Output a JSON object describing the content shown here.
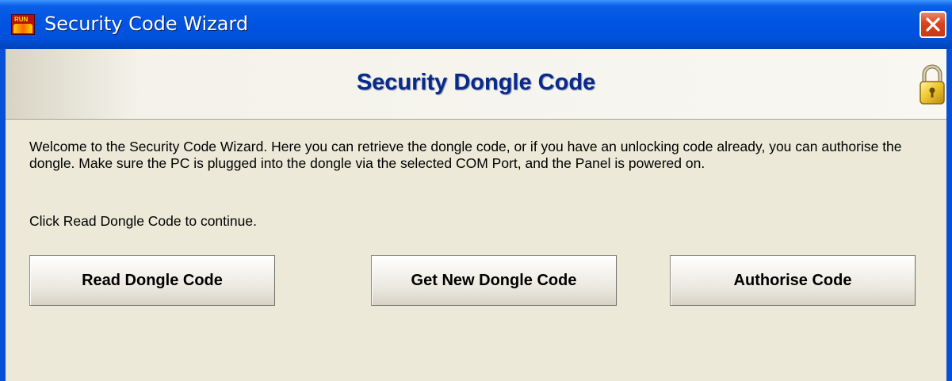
{
  "window": {
    "title": "Security Code Wizard",
    "app_icon_text": "RUN"
  },
  "header": {
    "title": "Security Dongle Code"
  },
  "body": {
    "paragraph": "Welcome to the Security Code Wizard. Here you can retrieve the dongle code, or if you have an unlocking code already, you can authorise the dongle. Make sure the PC is plugged into the dongle via the selected COM Port, and the Panel is powered on.",
    "instruction": "Click Read Dongle Code to continue."
  },
  "buttons": {
    "read": "Read Dongle Code",
    "get_new": "Get New Dongle Code",
    "authorise": "Authorise Code"
  },
  "colors": {
    "titlebar": "#0054e3",
    "header_title": "#0a2a8a",
    "close_button": "#d8441c",
    "background": "#ece9d8"
  },
  "icons": [
    "app-icon",
    "close-icon",
    "padlock-icon"
  ]
}
